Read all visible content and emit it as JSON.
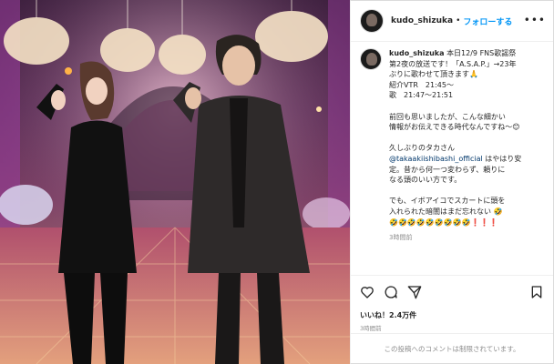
{
  "post": {
    "username": "kudo_shizuka",
    "separator": "•",
    "follow_label": "フォローする",
    "more_label": "•••"
  },
  "caption": {
    "username": "kudo_shizuka",
    "line1": "本日12/9 FNS歌謡祭",
    "line2": "第2夜の放送です！「A.S.A.P.」→23年",
    "line3": "ぶりに歌わせて頂きます🙏",
    "line4": "紹介VTR　21:45〜",
    "line5": "歌　21:47〜21:51",
    "para2_line1": "前回も思いましたが、こんな細かい",
    "para2_line2": "情報がお伝えできる時代なんですね〜😊",
    "para3_line1": "久しぶりのタカさん",
    "mention": "@takaakiishibashi_official",
    "para3_line2": " はやはり安",
    "para3_line3": "定。昔から何一つ変わらず、頼りに",
    "para3_line4": "なる頭のいい方です。",
    "para4_line1": "でも、イボアイコでスカートに頭を",
    "para4_line2": "入れられた暗闇はまだ忘れない 🤣",
    "para4_line3": "🤣🤣🤣🤣🤣🤣🤣🤣🤣❗❗❗",
    "time": "3時間前"
  },
  "actions": {
    "likes": "いいね！2.4万件",
    "time": "3時間前"
  },
  "footer": {
    "comments_disabled": "この投稿へのコメントは制限されています。"
  },
  "icons": {
    "heart": "heart-icon",
    "comment": "comment-icon",
    "share": "share-icon",
    "save": "bookmark-icon"
  }
}
